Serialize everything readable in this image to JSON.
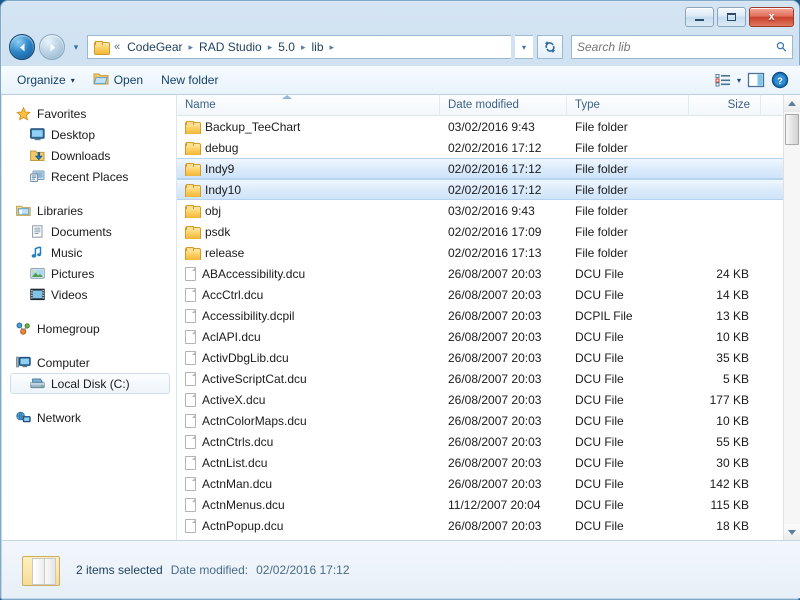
{
  "window": {
    "controls": {
      "minimize": "minimize",
      "maximize": "maximize",
      "close": "x"
    }
  },
  "address": {
    "back": "back-arrow",
    "forward": "forward-arrow",
    "history_dropdown": "▾",
    "crumb_prefix": "«",
    "crumbs": [
      "CodeGear",
      "RAD Studio",
      "5.0",
      "lib"
    ],
    "separator": "▸",
    "dropdown": "▾",
    "refresh": "refresh"
  },
  "search": {
    "placeholder": "Search lib",
    "value": "",
    "icon": "search-icon"
  },
  "toolbar": {
    "organize": "Organize",
    "organize_caret": "▾",
    "open": "Open",
    "new_folder": "New folder",
    "view_caret": "▾",
    "icons": [
      "view-layout-icon",
      "preview-pane-icon",
      "help-icon"
    ]
  },
  "navpane": {
    "groups": [
      {
        "header": {
          "label": "Favorites",
          "icon": "star-icon"
        },
        "items": [
          {
            "label": "Desktop",
            "icon": "desktop-icon"
          },
          {
            "label": "Downloads",
            "icon": "downloads-icon"
          },
          {
            "label": "Recent Places",
            "icon": "recent-places-icon"
          }
        ]
      },
      {
        "header": {
          "label": "Libraries",
          "icon": "libraries-icon"
        },
        "items": [
          {
            "label": "Documents",
            "icon": "documents-icon"
          },
          {
            "label": "Music",
            "icon": "music-icon"
          },
          {
            "label": "Pictures",
            "icon": "pictures-icon"
          },
          {
            "label": "Videos",
            "icon": "videos-icon"
          }
        ]
      },
      {
        "header": {
          "label": "Homegroup",
          "icon": "homegroup-icon"
        },
        "items": []
      },
      {
        "header": {
          "label": "Computer",
          "icon": "computer-icon"
        },
        "items": [
          {
            "label": "Local Disk (C:)",
            "icon": "hard-disk-icon",
            "selected": true
          }
        ]
      },
      {
        "header": {
          "label": "Network",
          "icon": "network-icon"
        },
        "items": []
      }
    ]
  },
  "filelist": {
    "columns": [
      "Name",
      "Date modified",
      "Type",
      "Size"
    ],
    "sort": {
      "column": "Name",
      "direction": "ascending"
    },
    "rows": [
      {
        "name": "Backup_TeeChart",
        "date": "03/02/2016 9:43",
        "type": "File folder",
        "size": "",
        "kind": "folder",
        "selected": false
      },
      {
        "name": "debug",
        "date": "02/02/2016 17:12",
        "type": "File folder",
        "size": "",
        "kind": "folder",
        "selected": false
      },
      {
        "name": "Indy9",
        "date": "02/02/2016 17:12",
        "type": "File folder",
        "size": "",
        "kind": "folder",
        "selected": true
      },
      {
        "name": "Indy10",
        "date": "02/02/2016 17:12",
        "type": "File folder",
        "size": "",
        "kind": "folder",
        "selected": true
      },
      {
        "name": "obj",
        "date": "03/02/2016 9:43",
        "type": "File folder",
        "size": "",
        "kind": "folder",
        "selected": false
      },
      {
        "name": "psdk",
        "date": "02/02/2016 17:09",
        "type": "File folder",
        "size": "",
        "kind": "folder",
        "selected": false
      },
      {
        "name": "release",
        "date": "02/02/2016 17:13",
        "type": "File folder",
        "size": "",
        "kind": "folder",
        "selected": false
      },
      {
        "name": "ABAccessibility.dcu",
        "date": "26/08/2007 20:03",
        "type": "DCU File",
        "size": "24 KB",
        "kind": "file",
        "selected": false
      },
      {
        "name": "AccCtrl.dcu",
        "date": "26/08/2007 20:03",
        "type": "DCU File",
        "size": "14 KB",
        "kind": "file",
        "selected": false
      },
      {
        "name": "Accessibility.dcpil",
        "date": "26/08/2007 20:03",
        "type": "DCPIL File",
        "size": "13 KB",
        "kind": "file",
        "selected": false
      },
      {
        "name": "AclAPI.dcu",
        "date": "26/08/2007 20:03",
        "type": "DCU File",
        "size": "10 KB",
        "kind": "file",
        "selected": false
      },
      {
        "name": "ActivDbgLib.dcu",
        "date": "26/08/2007 20:03",
        "type": "DCU File",
        "size": "35 KB",
        "kind": "file",
        "selected": false
      },
      {
        "name": "ActiveScriptCat.dcu",
        "date": "26/08/2007 20:03",
        "type": "DCU File",
        "size": "5 KB",
        "kind": "file",
        "selected": false
      },
      {
        "name": "ActiveX.dcu",
        "date": "26/08/2007 20:03",
        "type": "DCU File",
        "size": "177 KB",
        "kind": "file",
        "selected": false
      },
      {
        "name": "ActnColorMaps.dcu",
        "date": "26/08/2007 20:03",
        "type": "DCU File",
        "size": "10 KB",
        "kind": "file",
        "selected": false
      },
      {
        "name": "ActnCtrls.dcu",
        "date": "26/08/2007 20:03",
        "type": "DCU File",
        "size": "55 KB",
        "kind": "file",
        "selected": false
      },
      {
        "name": "ActnList.dcu",
        "date": "26/08/2007 20:03",
        "type": "DCU File",
        "size": "30 KB",
        "kind": "file",
        "selected": false
      },
      {
        "name": "ActnMan.dcu",
        "date": "26/08/2007 20:03",
        "type": "DCU File",
        "size": "142 KB",
        "kind": "file",
        "selected": false
      },
      {
        "name": "ActnMenus.dcu",
        "date": "11/12/2007 20:04",
        "type": "DCU File",
        "size": "115 KB",
        "kind": "file",
        "selected": false
      },
      {
        "name": "ActnPopup.dcu",
        "date": "26/08/2007 20:03",
        "type": "DCU File",
        "size": "18 KB",
        "kind": "file",
        "selected": false
      }
    ]
  },
  "statusbar": {
    "selection": "2 items selected",
    "date_label": "Date modified:",
    "date_value": "02/02/2016 17:12",
    "icon": "folders-icon"
  },
  "colors": {
    "selection_fill": "#dcebfb",
    "selection_border": "#b6d4ef",
    "frame": "#c3daee",
    "accent": "#1c3f5f",
    "close_button": "#c9402c"
  }
}
